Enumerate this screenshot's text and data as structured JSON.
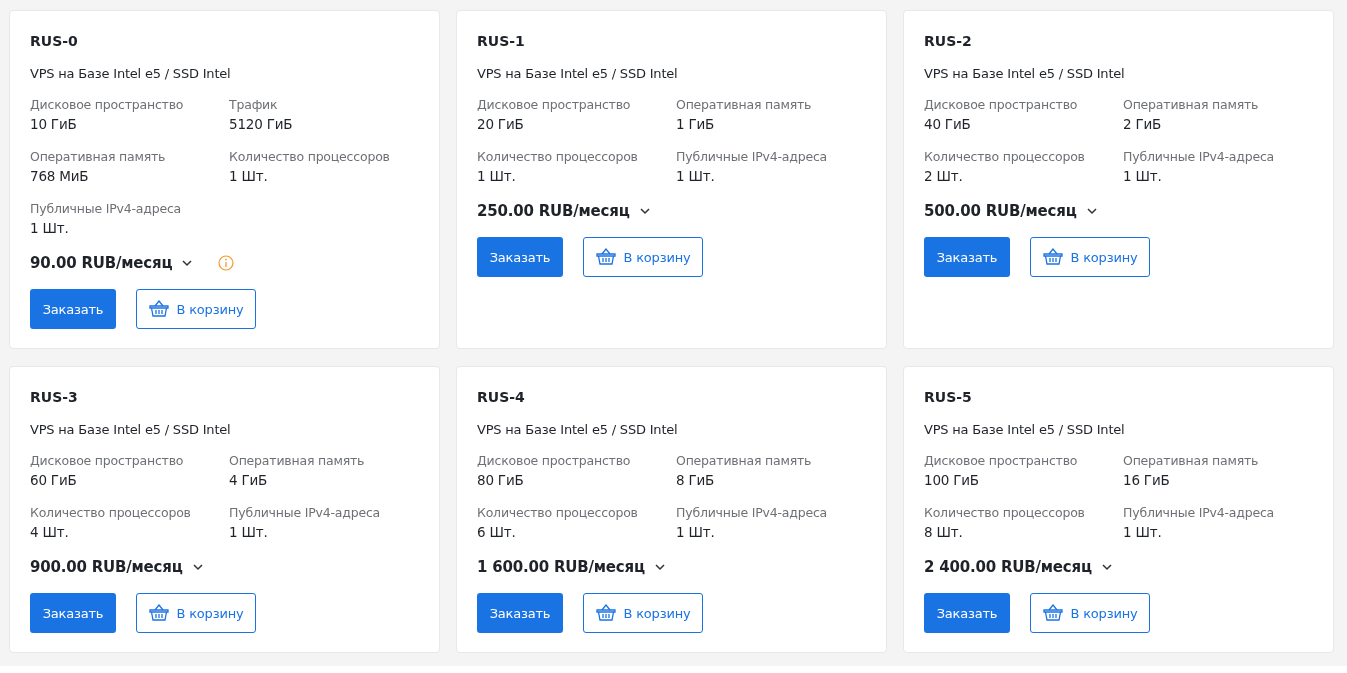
{
  "plans": [
    {
      "name": "RUS-0",
      "description": "VPS на Базе Intel e5 / SSD Intel",
      "specs": [
        {
          "label": "Дисковое пространство",
          "value": "10 ГиБ"
        },
        {
          "label": "Трафик",
          "value": "5120 ГиБ"
        },
        {
          "label": "Оперативная память",
          "value": "768 МиБ"
        },
        {
          "label": "Количество процессоров",
          "value": "1 Шт."
        },
        {
          "label": "Публичные IPv4-адреса",
          "value": "1 Шт."
        }
      ],
      "price": "90.00 RUB/месяц",
      "info": true,
      "order_button": "Заказать",
      "cart_button": "В корзину"
    },
    {
      "name": "RUS-1",
      "description": "VPS на Базе Intel e5 / SSD Intel",
      "specs": [
        {
          "label": "Дисковое пространство",
          "value": "20 ГиБ"
        },
        {
          "label": "Оперативная память",
          "value": "1 ГиБ"
        },
        {
          "label": "Количество процессоров",
          "value": "1 Шт."
        },
        {
          "label": "Публичные IPv4-адреса",
          "value": "1 Шт."
        }
      ],
      "price": "250.00 RUB/месяц",
      "info": false,
      "order_button": "Заказать",
      "cart_button": "В корзину"
    },
    {
      "name": "RUS-2",
      "description": "VPS на Базе Intel e5 / SSD Intel",
      "specs": [
        {
          "label": "Дисковое пространство",
          "value": "40 ГиБ"
        },
        {
          "label": "Оперативная память",
          "value": "2 ГиБ"
        },
        {
          "label": "Количество процессоров",
          "value": "2 Шт."
        },
        {
          "label": "Публичные IPv4-адреса",
          "value": "1 Шт."
        }
      ],
      "price": "500.00 RUB/месяц",
      "info": false,
      "order_button": "Заказать",
      "cart_button": "В корзину"
    },
    {
      "name": "RUS-3",
      "description": "VPS на Базе Intel e5 / SSD Intel",
      "specs": [
        {
          "label": "Дисковое пространство",
          "value": "60 ГиБ"
        },
        {
          "label": "Оперативная память",
          "value": "4 ГиБ"
        },
        {
          "label": "Количество процессоров",
          "value": "4 Шт."
        },
        {
          "label": "Публичные IPv4-адреса",
          "value": "1 Шт."
        }
      ],
      "price": "900.00 RUB/месяц",
      "info": false,
      "order_button": "Заказать",
      "cart_button": "В корзину"
    },
    {
      "name": "RUS-4",
      "description": "VPS на Базе Intel e5 / SSD Intel",
      "specs": [
        {
          "label": "Дисковое пространство",
          "value": "80 ГиБ"
        },
        {
          "label": "Оперативная память",
          "value": "8 ГиБ"
        },
        {
          "label": "Количество процессоров",
          "value": "6 Шт."
        },
        {
          "label": "Публичные IPv4-адреса",
          "value": "1 Шт."
        }
      ],
      "price": "1 600.00 RUB/месяц",
      "info": false,
      "order_button": "Заказать",
      "cart_button": "В корзину"
    },
    {
      "name": "RUS-5",
      "description": "VPS на Базе Intel e5 / SSD Intel",
      "specs": [
        {
          "label": "Дисковое пространство",
          "value": "100 ГиБ"
        },
        {
          "label": "Оперативная память",
          "value": "16 ГиБ"
        },
        {
          "label": "Количество процессоров",
          "value": "8 Шт."
        },
        {
          "label": "Публичные IPv4-адреса",
          "value": "1 Шт."
        }
      ],
      "price": "2 400.00 RUB/месяц",
      "info": false,
      "order_button": "Заказать",
      "cart_button": "В корзину"
    }
  ]
}
